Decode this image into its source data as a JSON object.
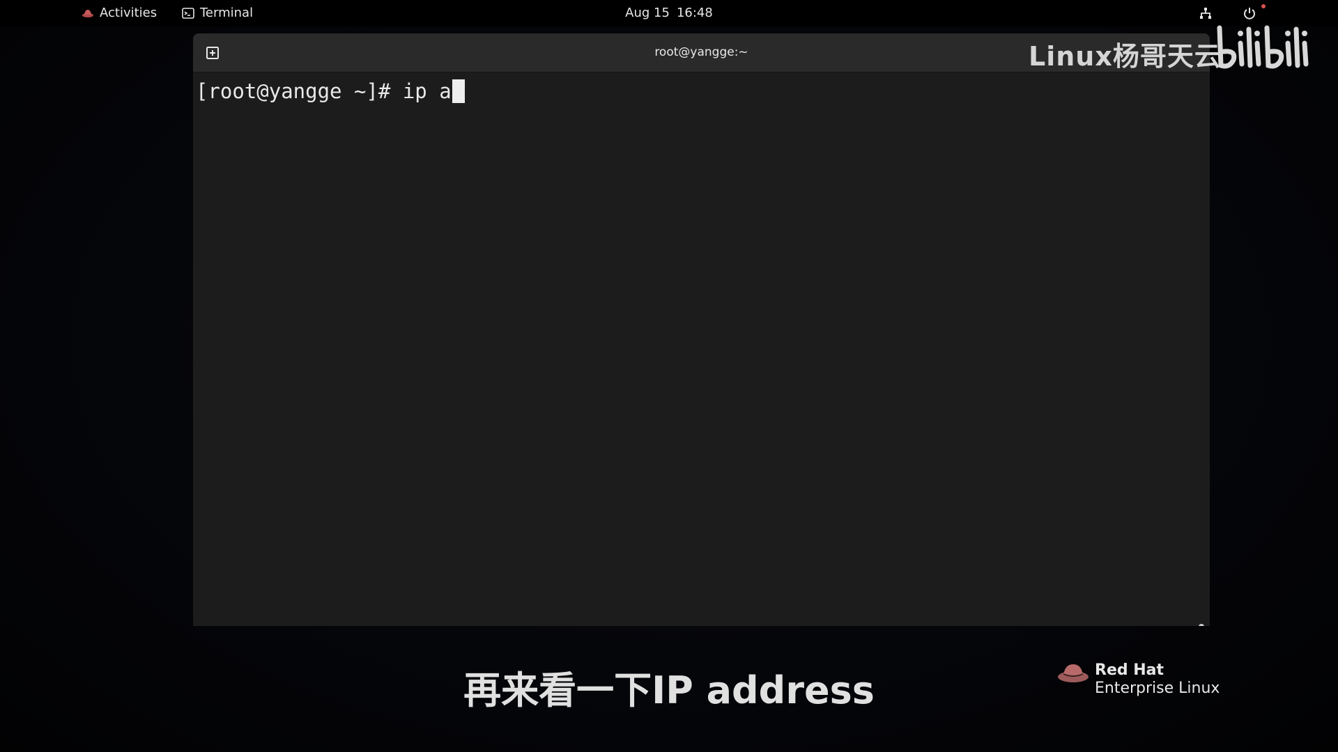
{
  "topbar": {
    "activities_label": "Activities",
    "app_label": "Terminal",
    "date": "Aug 15",
    "time": "16:48",
    "icons": [
      "redhat-icon",
      "terminal-icon",
      "network-icon",
      "power-icon"
    ]
  },
  "terminal": {
    "title": "root@yangge:~",
    "prompt": "[root@yangge ~]# ",
    "command": "ip a"
  },
  "watermark": {
    "channel": "Linux杨哥天云",
    "platform": "bilibili"
  },
  "subtitle": "再来看一下IP address",
  "branding": {
    "line1": "Red Hat",
    "line2": "Enterprise Linux"
  },
  "colors": {
    "accent_red": "#d9534f",
    "terminal_bg": "#1c1c1c",
    "titlebar_bg": "#2a2a2a"
  }
}
